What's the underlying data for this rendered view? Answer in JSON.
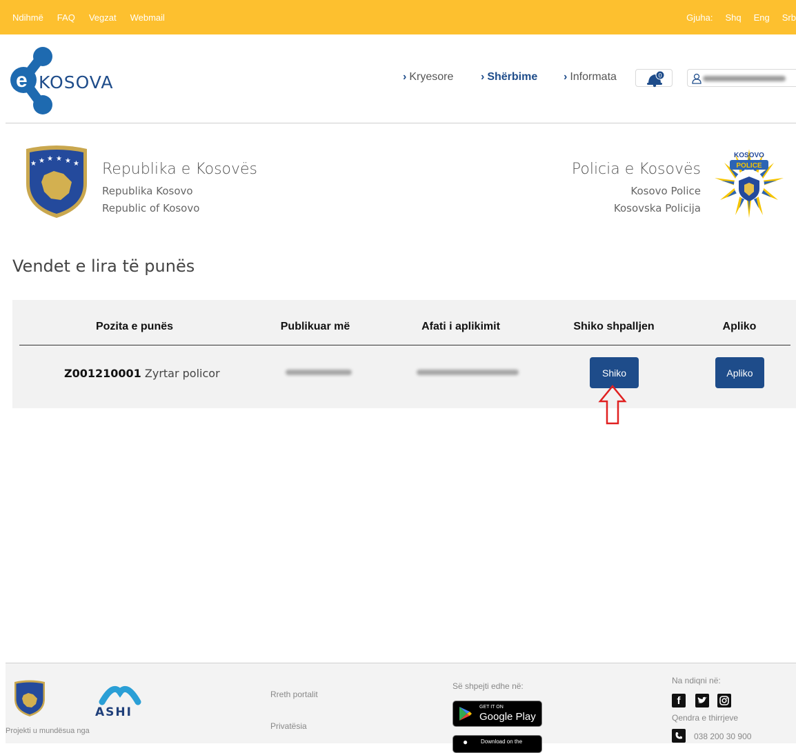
{
  "topbar": {
    "left_links": [
      "Ndihmë",
      "FAQ",
      "Vegzat",
      "Webmail"
    ],
    "language_label": "Gjuha:",
    "languages": [
      "Shq",
      "Eng",
      "Srb"
    ]
  },
  "header": {
    "logo_letter": "e",
    "logo_text": "KOSOVA",
    "nav": [
      {
        "label": "Kryesore"
      },
      {
        "label": "Shërbime"
      },
      {
        "label": "Informata"
      }
    ],
    "notification_count": "0"
  },
  "institution_left": {
    "name": "Republika e Kosovës",
    "line2": "Republika Kosovo",
    "line3": "Republic of Kosovo"
  },
  "institution_right": {
    "name": "Policia e Kosovës",
    "line2": "Kosovo Police",
    "line3": "Kosovska Policija",
    "badge_top": "KOSOVO",
    "badge_band": "POLICE"
  },
  "page_title": "Vendet e lira të punës",
  "table": {
    "headers": [
      "Pozita e punës",
      "Publikuar më",
      "Afati i aplikimit",
      "Shiko shpalljen",
      "Apliko"
    ],
    "row": {
      "code": "Z001210001",
      "position": "Zyrtar policor",
      "view_button": "Shiko",
      "apply_button": "Apliko"
    }
  },
  "footer": {
    "project_text": "Projekti u mundësua nga",
    "ashi_text": "ASHI",
    "links": [
      "Rreth portalit",
      "Privatësia"
    ],
    "apps_label": "Së shpejti edhe në:",
    "google_small": "GET IT ON",
    "google_big": "Google Play",
    "apple_small": "Download on the",
    "follow_label": "Na ndiqni në:",
    "call_center_label": "Qendra e thirrjeve",
    "phone": "038 200 30 900"
  },
  "colors": {
    "topbar": "#fdc02f",
    "brand_blue": "#1e4c8a",
    "panel": "#f2f2f2",
    "annotation_red": "#e02020"
  }
}
